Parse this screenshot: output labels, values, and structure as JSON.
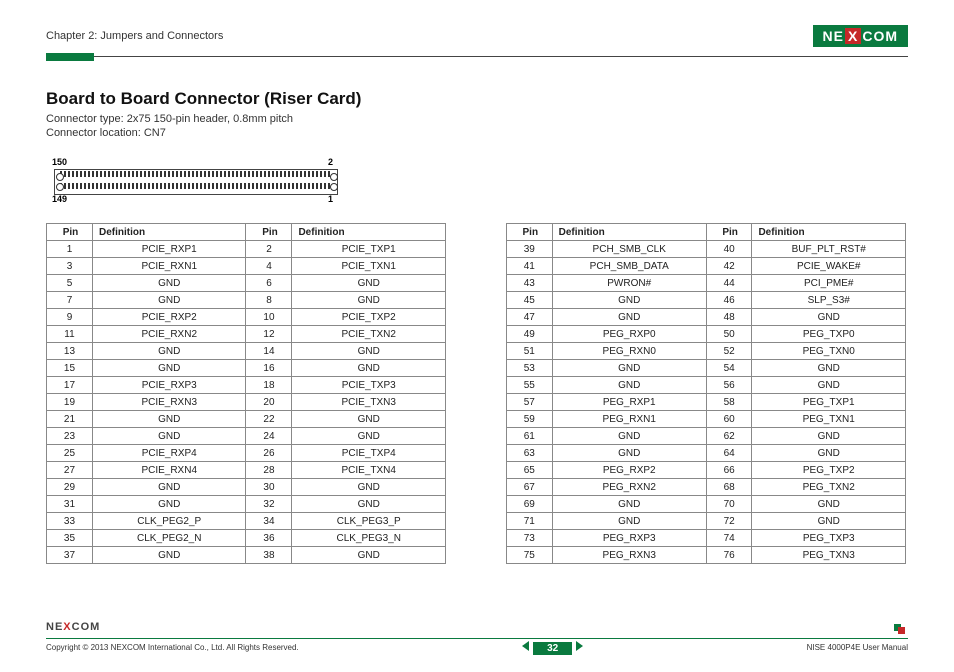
{
  "header": {
    "chapter": "Chapter 2: Jumpers and Connectors",
    "logo_text_left": "NE",
    "logo_text_x": "X",
    "logo_text_right": "COM"
  },
  "section": {
    "title": "Board to Board Connector (Riser Card)",
    "sub1": "Connector type: 2x75 150-pin header, 0.8mm pitch",
    "sub2": "Connector location: CN7"
  },
  "diagram_labels": {
    "top_left": "150",
    "top_right": "2",
    "bottom_left": "149",
    "bottom_right": "1"
  },
  "table_headers": [
    "Pin",
    "Definition",
    "Pin",
    "Definition"
  ],
  "table_left": [
    [
      "1",
      "PCIE_RXP1",
      "2",
      "PCIE_TXP1"
    ],
    [
      "3",
      "PCIE_RXN1",
      "4",
      "PCIE_TXN1"
    ],
    [
      "5",
      "GND",
      "6",
      "GND"
    ],
    [
      "7",
      "GND",
      "8",
      "GND"
    ],
    [
      "9",
      "PCIE_RXP2",
      "10",
      "PCIE_TXP2"
    ],
    [
      "11",
      "PCIE_RXN2",
      "12",
      "PCIE_TXN2"
    ],
    [
      "13",
      "GND",
      "14",
      "GND"
    ],
    [
      "15",
      "GND",
      "16",
      "GND"
    ],
    [
      "17",
      "PCIE_RXP3",
      "18",
      "PCIE_TXP3"
    ],
    [
      "19",
      "PCIE_RXN3",
      "20",
      "PCIE_TXN3"
    ],
    [
      "21",
      "GND",
      "22",
      "GND"
    ],
    [
      "23",
      "GND",
      "24",
      "GND"
    ],
    [
      "25",
      "PCIE_RXP4",
      "26",
      "PCIE_TXP4"
    ],
    [
      "27",
      "PCIE_RXN4",
      "28",
      "PCIE_TXN4"
    ],
    [
      "29",
      "GND",
      "30",
      "GND"
    ],
    [
      "31",
      "GND",
      "32",
      "GND"
    ],
    [
      "33",
      "CLK_PEG2_P",
      "34",
      "CLK_PEG3_P"
    ],
    [
      "35",
      "CLK_PEG2_N",
      "36",
      "CLK_PEG3_N"
    ],
    [
      "37",
      "GND",
      "38",
      "GND"
    ]
  ],
  "table_right": [
    [
      "39",
      "PCH_SMB_CLK",
      "40",
      "BUF_PLT_RST#"
    ],
    [
      "41",
      "PCH_SMB_DATA",
      "42",
      "PCIE_WAKE#"
    ],
    [
      "43",
      "PWRON#",
      "44",
      "PCI_PME#"
    ],
    [
      "45",
      "GND",
      "46",
      "SLP_S3#"
    ],
    [
      "47",
      "GND",
      "48",
      "GND"
    ],
    [
      "49",
      "PEG_RXP0",
      "50",
      "PEG_TXP0"
    ],
    [
      "51",
      "PEG_RXN0",
      "52",
      "PEG_TXN0"
    ],
    [
      "53",
      "GND",
      "54",
      "GND"
    ],
    [
      "55",
      "GND",
      "56",
      "GND"
    ],
    [
      "57",
      "PEG_RXP1",
      "58",
      "PEG_TXP1"
    ],
    [
      "59",
      "PEG_RXN1",
      "60",
      "PEG_TXN1"
    ],
    [
      "61",
      "GND",
      "62",
      "GND"
    ],
    [
      "63",
      "GND",
      "64",
      "GND"
    ],
    [
      "65",
      "PEG_RXP2",
      "66",
      "PEG_TXP2"
    ],
    [
      "67",
      "PEG_RXN2",
      "68",
      "PEG_TXN2"
    ],
    [
      "69",
      "GND",
      "70",
      "GND"
    ],
    [
      "71",
      "GND",
      "72",
      "GND"
    ],
    [
      "73",
      "PEG_RXP3",
      "74",
      "PEG_TXP3"
    ],
    [
      "75",
      "PEG_RXN3",
      "76",
      "PEG_TXN3"
    ]
  ],
  "footer": {
    "copyright": "Copyright © 2013 NEXCOM International Co., Ltd. All Rights Reserved.",
    "page_number": "32",
    "manual_name": "NISE 4000P4E User Manual"
  }
}
